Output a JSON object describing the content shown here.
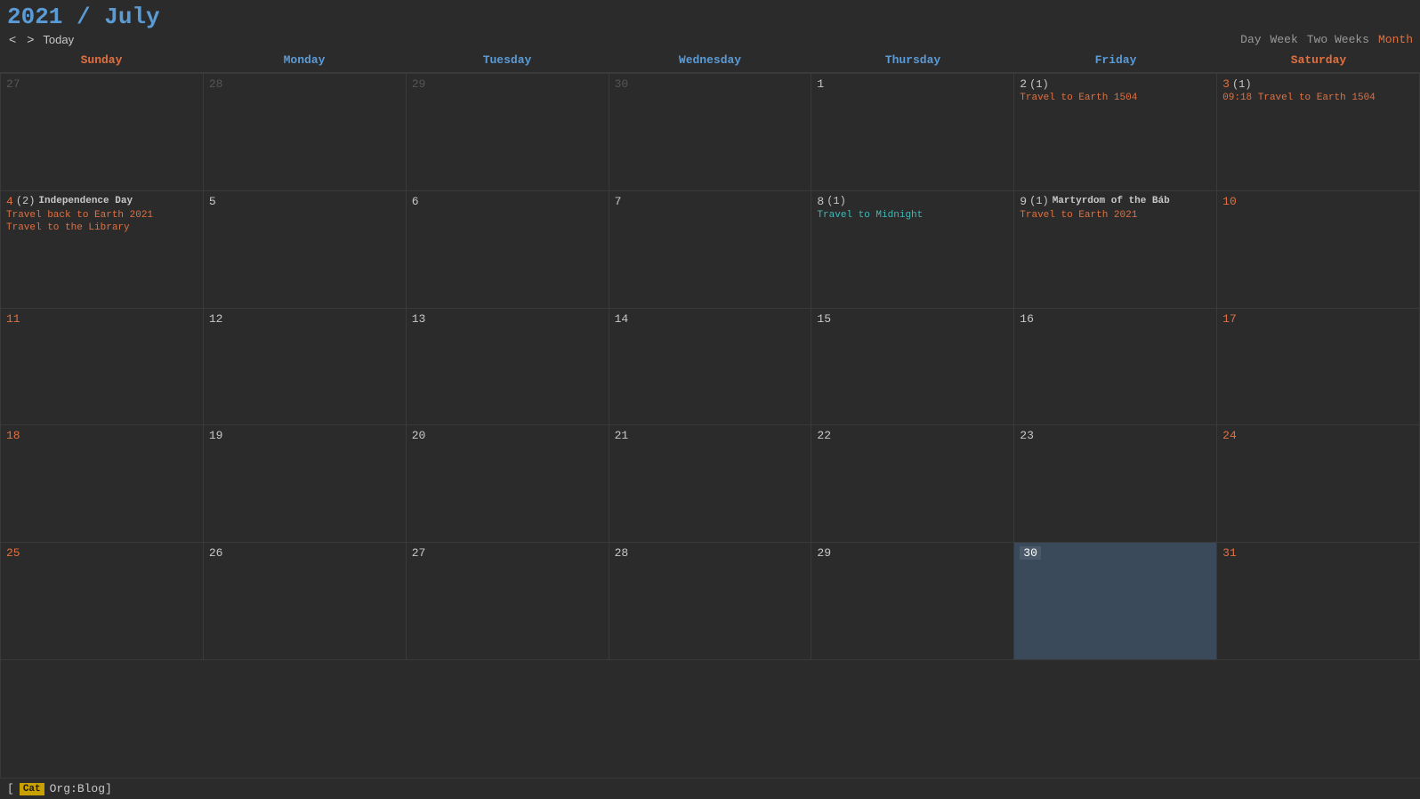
{
  "header": {
    "title_year": "2021",
    "title_slash": "/",
    "title_month": "July",
    "nav_prev": "<",
    "nav_next": ">",
    "nav_today": "Today",
    "views": [
      {
        "label": "Day",
        "active": false
      },
      {
        "label": "Week",
        "active": false
      },
      {
        "label": "Two Weeks",
        "active": false
      },
      {
        "label": "Month",
        "active": true
      }
    ]
  },
  "days_header": [
    {
      "label": "Sunday",
      "type": "weekend"
    },
    {
      "label": "Monday",
      "type": "weekday"
    },
    {
      "label": "Tuesday",
      "type": "weekday"
    },
    {
      "label": "Wednesday",
      "type": "weekday"
    },
    {
      "label": "Thursday",
      "type": "weekday"
    },
    {
      "label": "Friday",
      "type": "weekday"
    },
    {
      "label": "Saturday",
      "type": "weekend"
    }
  ],
  "weeks": [
    [
      {
        "day": "27",
        "outside": true,
        "type": "sunday",
        "events": []
      },
      {
        "day": "28",
        "outside": true,
        "type": "monday",
        "events": []
      },
      {
        "day": "29",
        "outside": true,
        "type": "tuesday",
        "events": []
      },
      {
        "day": "30",
        "outside": true,
        "type": "wednesday",
        "events": []
      },
      {
        "day": "1",
        "outside": false,
        "type": "thursday",
        "events": []
      },
      {
        "day": "2",
        "outside": false,
        "type": "friday",
        "count": "(1)",
        "events": [
          {
            "text": "Travel to Earth 1504",
            "style": "orange"
          }
        ]
      },
      {
        "day": "3",
        "outside": false,
        "type": "saturday",
        "count": "(1)",
        "events": [
          {
            "text": "09:18 Travel to Earth 1504",
            "style": "orange"
          }
        ]
      }
    ],
    [
      {
        "day": "4",
        "outside": false,
        "type": "sunday",
        "count": "(2)",
        "events": [
          {
            "text": "Independence Day",
            "style": "holiday"
          },
          {
            "text": "Travel back to Earth 2021",
            "style": "orange"
          },
          {
            "text": "Travel to the Library",
            "style": "orange"
          }
        ]
      },
      {
        "day": "5",
        "outside": false,
        "type": "monday",
        "events": []
      },
      {
        "day": "6",
        "outside": false,
        "type": "tuesday",
        "events": []
      },
      {
        "day": "7",
        "outside": false,
        "type": "wednesday",
        "events": []
      },
      {
        "day": "8",
        "outside": false,
        "type": "thursday",
        "count": "(1)",
        "events": [
          {
            "text": "Travel to Midnight",
            "style": "cyan"
          }
        ]
      },
      {
        "day": "9",
        "outside": false,
        "type": "friday",
        "count": "(1)",
        "events": [
          {
            "text": "Martyrdom of the Báb",
            "style": "holiday"
          },
          {
            "text": "Travel to Earth 2021",
            "style": "orange"
          }
        ]
      },
      {
        "day": "10",
        "outside": false,
        "type": "saturday",
        "events": []
      }
    ],
    [
      {
        "day": "11",
        "outside": false,
        "type": "sunday",
        "events": []
      },
      {
        "day": "12",
        "outside": false,
        "type": "monday",
        "events": []
      },
      {
        "day": "13",
        "outside": false,
        "type": "tuesday",
        "events": []
      },
      {
        "day": "14",
        "outside": false,
        "type": "wednesday",
        "events": []
      },
      {
        "day": "15",
        "outside": false,
        "type": "thursday",
        "events": []
      },
      {
        "day": "16",
        "outside": false,
        "type": "friday",
        "events": []
      },
      {
        "day": "17",
        "outside": false,
        "type": "saturday",
        "events": []
      }
    ],
    [
      {
        "day": "18",
        "outside": false,
        "type": "sunday",
        "events": []
      },
      {
        "day": "19",
        "outside": false,
        "type": "monday",
        "events": []
      },
      {
        "day": "20",
        "outside": false,
        "type": "tuesday",
        "events": []
      },
      {
        "day": "21",
        "outside": false,
        "type": "wednesday",
        "events": []
      },
      {
        "day": "22",
        "outside": false,
        "type": "thursday",
        "events": []
      },
      {
        "day": "23",
        "outside": false,
        "type": "friday",
        "events": []
      },
      {
        "day": "24",
        "outside": false,
        "type": "saturday",
        "events": []
      }
    ],
    [
      {
        "day": "25",
        "outside": false,
        "type": "sunday",
        "events": []
      },
      {
        "day": "26",
        "outside": false,
        "type": "monday",
        "events": []
      },
      {
        "day": "27",
        "outside": false,
        "type": "tuesday",
        "events": []
      },
      {
        "day": "28",
        "outside": false,
        "type": "wednesday",
        "events": []
      },
      {
        "day": "29",
        "outside": false,
        "type": "thursday",
        "events": []
      },
      {
        "day": "30",
        "outside": false,
        "type": "friday",
        "today": true,
        "events": []
      },
      {
        "day": "31",
        "outside": false,
        "type": "saturday",
        "events": []
      }
    ]
  ],
  "footer": {
    "badge": "Cat",
    "text": "Org:Blog]"
  }
}
